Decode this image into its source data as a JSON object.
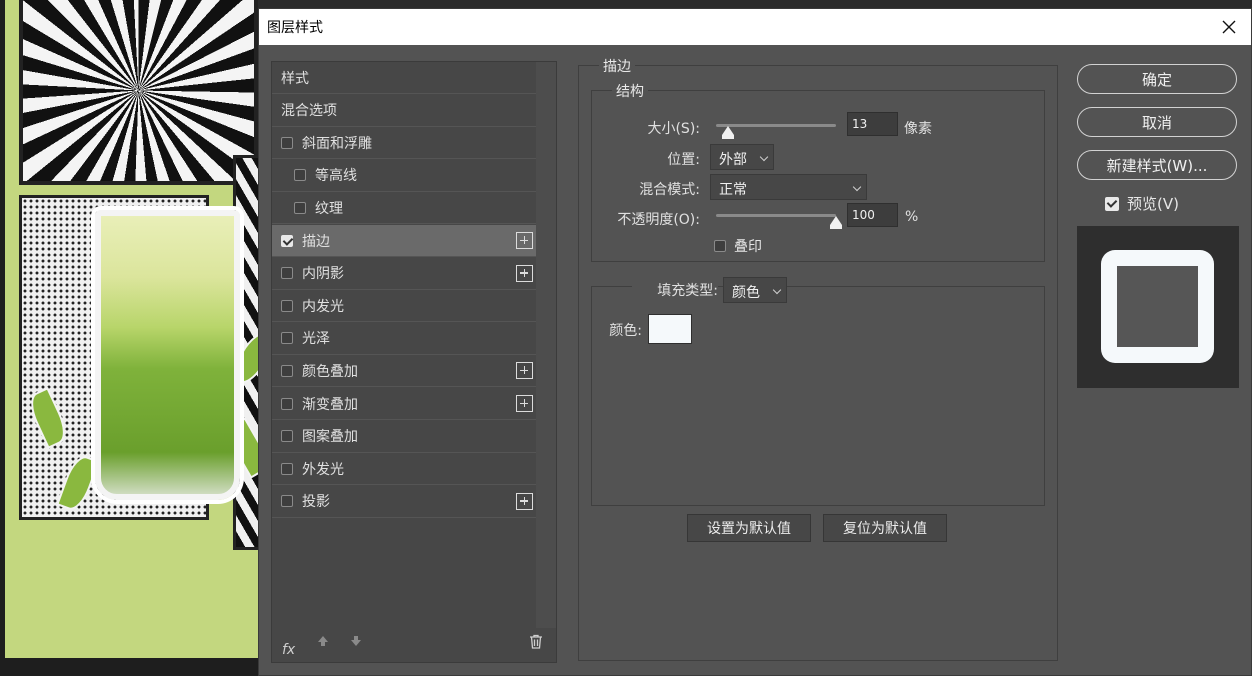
{
  "dialog": {
    "title": "图层样式"
  },
  "style_list": {
    "items": [
      {
        "label": "样式",
        "checkbox": false,
        "checked": false,
        "indent": false,
        "plus": false,
        "selected": false
      },
      {
        "label": "混合选项",
        "checkbox": false,
        "checked": false,
        "indent": false,
        "plus": false,
        "selected": false
      },
      {
        "label": "斜面和浮雕",
        "checkbox": true,
        "checked": false,
        "indent": false,
        "plus": false,
        "selected": false
      },
      {
        "label": "等高线",
        "checkbox": true,
        "checked": false,
        "indent": true,
        "plus": false,
        "selected": false
      },
      {
        "label": "纹理",
        "checkbox": true,
        "checked": false,
        "indent": true,
        "plus": false,
        "selected": false
      },
      {
        "label": "描边",
        "checkbox": true,
        "checked": true,
        "indent": false,
        "plus": true,
        "selected": true
      },
      {
        "label": "内阴影",
        "checkbox": true,
        "checked": false,
        "indent": false,
        "plus": true,
        "selected": false
      },
      {
        "label": "内发光",
        "checkbox": true,
        "checked": false,
        "indent": false,
        "plus": false,
        "selected": false
      },
      {
        "label": "光泽",
        "checkbox": true,
        "checked": false,
        "indent": false,
        "plus": false,
        "selected": false
      },
      {
        "label": "颜色叠加",
        "checkbox": true,
        "checked": false,
        "indent": false,
        "plus": true,
        "selected": false
      },
      {
        "label": "渐变叠加",
        "checkbox": true,
        "checked": false,
        "indent": false,
        "plus": true,
        "selected": false
      },
      {
        "label": "图案叠加",
        "checkbox": true,
        "checked": false,
        "indent": false,
        "plus": false,
        "selected": false
      },
      {
        "label": "外发光",
        "checkbox": true,
        "checked": false,
        "indent": false,
        "plus": false,
        "selected": false
      },
      {
        "label": "投影",
        "checkbox": true,
        "checked": false,
        "indent": false,
        "plus": true,
        "selected": false
      }
    ],
    "footer": {
      "fx_label": "fx"
    }
  },
  "stroke": {
    "section_title": "描边",
    "structure_title": "结构",
    "size": {
      "label": "大小(S):",
      "value": "13",
      "unit": "像素",
      "slider_fraction": 0.1
    },
    "position": {
      "label": "位置:",
      "value": "外部"
    },
    "blend_mode": {
      "label": "混合模式:",
      "value": "正常"
    },
    "opacity": {
      "label": "不透明度(O):",
      "value": "100",
      "unit": "%",
      "slider_fraction": 1.0
    },
    "overprint": {
      "label": "叠印",
      "checked": false
    },
    "fill_type": {
      "label": "填充类型:",
      "value": "颜色"
    },
    "color": {
      "label": "颜色:",
      "swatch": "#f5f9fb"
    },
    "make_default": "设置为默认值",
    "reset_default": "复位为默认值"
  },
  "actions": {
    "ok": "确定",
    "cancel": "取消",
    "new_style": "新建样式(W)...",
    "preview_label": "预览(V)",
    "preview_checked": true
  }
}
